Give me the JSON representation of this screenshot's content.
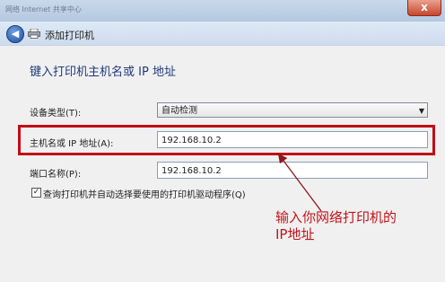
{
  "titlebar": {
    "text": "网络 Internet 共享中心 ",
    "close_label": "x"
  },
  "nav": {
    "back_label": "◀",
    "title": "添加打印机"
  },
  "heading": "键入打印机主机名或 IP 地址",
  "device_type": {
    "label": "设备类型(T):",
    "value": "自动检测"
  },
  "hostname": {
    "label": "主机名或 IP 地址(A):",
    "value": "192.168.10.2"
  },
  "port_name": {
    "label": "端口名称(P):",
    "value": "192.168.10.2"
  },
  "query_checkbox": {
    "label": "查询打印机并自动选择要使用的打印机驱动程序(Q)",
    "checked": true,
    "mark": "✓"
  },
  "annotation": {
    "line1": "输入你网络打印机的",
    "line2": "IP地址"
  },
  "colors": {
    "annotation": "#c2141b",
    "heading": "#1f3a7a"
  }
}
